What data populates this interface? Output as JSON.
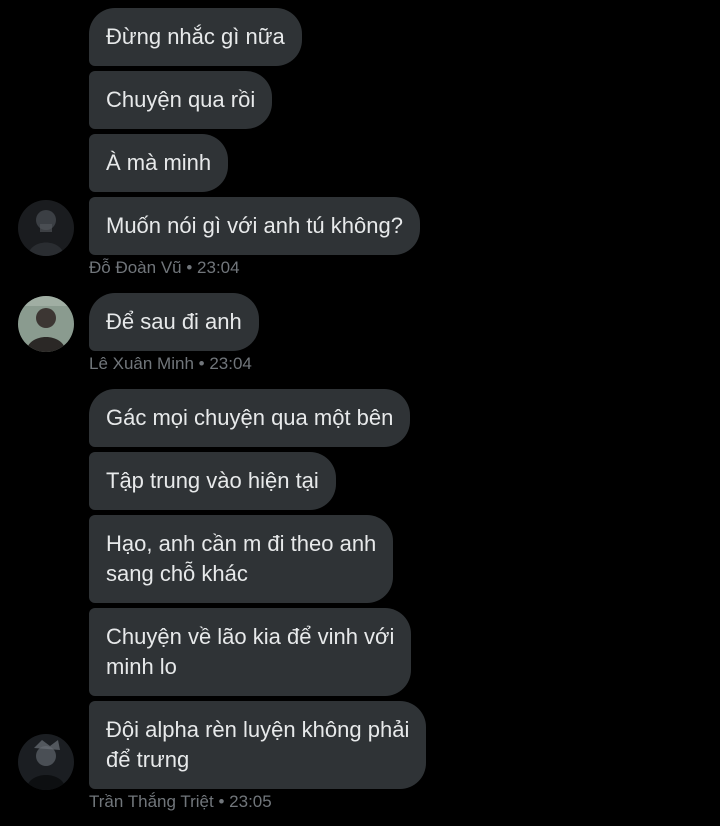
{
  "groups": [
    {
      "sender": "Đỗ Đoàn Vũ",
      "time": "23:04",
      "messages": [
        "Đừng nhắc gì nữa",
        "Chuyện qua rồi",
        "À mà minh",
        "Muốn nói gì với anh tú không?"
      ]
    },
    {
      "sender": "Lê Xuân Minh",
      "time": "23:04",
      "messages": [
        "Để sau đi anh"
      ]
    },
    {
      "sender": "Trần Thắng Triệt",
      "time": "23:05",
      "messages": [
        "Gác mọi chuyện qua một bên",
        "Tập trung vào hiện tại",
        "Hạo, anh cần m đi theo anh\nsang chỗ khác",
        "Chuyện về lão kia để vinh với\nminh lo",
        "Đội alpha rèn luyện không phải\nđể trưng"
      ]
    }
  ],
  "separator": "•",
  "colors": {
    "background": "#000000",
    "bubble": "#2f3336",
    "text": "#e7e9ea",
    "meta": "#71767b"
  },
  "icons": [
    "avatar-do-doan-vu",
    "avatar-le-xuan-minh",
    "avatar-tran-thang-triet"
  ]
}
